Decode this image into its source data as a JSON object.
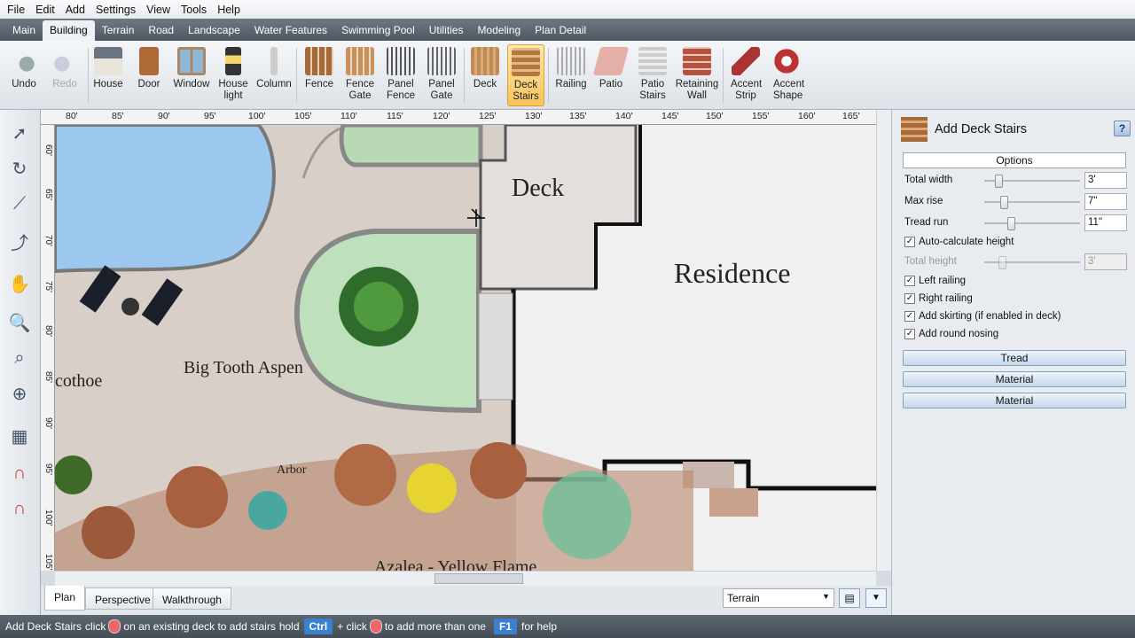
{
  "menu": [
    "File",
    "Edit",
    "Add",
    "Settings",
    "View",
    "Tools",
    "Help"
  ],
  "tabs": [
    "Main",
    "Building",
    "Terrain",
    "Road",
    "Landscape",
    "Water Features",
    "Swimming Pool",
    "Utilities",
    "Modeling",
    "Plan Detail"
  ],
  "active_tab": "Building",
  "ribbon": {
    "undo": "Undo",
    "redo": "Redo",
    "house": "House",
    "door": "Door",
    "window": "Window",
    "house_light": "House light",
    "column": "Column",
    "fence": "Fence",
    "fence_gate": "Fence Gate",
    "panel_fence": "Panel Fence",
    "panel_gate": "Panel Gate",
    "deck": "Deck",
    "deck_stairs": "Deck Stairs",
    "railing": "Railing",
    "patio": "Patio",
    "patio_stairs": "Patio Stairs",
    "retaining_wall": "Retaining Wall",
    "accent_strip": "Accent Strip",
    "accent_shape": "Accent Shape"
  },
  "ruler_h": [
    "80'",
    "85'",
    "90'",
    "95'",
    "100'",
    "105'",
    "110'",
    "115'",
    "120'",
    "125'",
    "130'",
    "135'",
    "140'",
    "145'",
    "150'",
    "155'",
    "160'",
    "165'"
  ],
  "ruler_v": [
    "60'",
    "65'",
    "70'",
    "75'",
    "80'",
    "85'",
    "90'",
    "95'",
    "100'",
    "105'"
  ],
  "canvas_labels": {
    "deck": "Deck",
    "residence": "Residence",
    "aspen": "Big Tooth Aspen",
    "cotoneaster": "cothoe",
    "arbor": "Arbor",
    "azalea": "Azalea - Yellow Flame"
  },
  "view_tabs": {
    "plan": "Plan",
    "perspective": "Perspective",
    "walkthrough": "Walkthrough"
  },
  "layer_select": "Terrain",
  "panel": {
    "title": "Add Deck Stairs",
    "help": "?",
    "options": "Options",
    "total_width_label": "Total width",
    "total_width": "3'",
    "max_rise_label": "Max rise",
    "max_rise": "7\"",
    "tread_run_label": "Tread run",
    "tread_run": "11\"",
    "auto_height": "Auto-calculate height",
    "total_height_label": "Total height",
    "total_height": "3'",
    "left_railing": "Left railing",
    "right_railing": "Right railing",
    "add_skirting": "Add skirting (if enabled in deck)",
    "add_nosing": "Add round nosing",
    "btn_tread": "Tread",
    "btn_material1": "Material",
    "btn_material2": "Material"
  },
  "status": {
    "mode": "Add Deck Stairs",
    "t1": "click",
    "t2": "on an existing deck to add stairs",
    "t3": "hold",
    "ctrl": "Ctrl",
    "t4": "+ click",
    "t5": "to add more than one",
    "f1": "F1",
    "t6": "for help"
  }
}
